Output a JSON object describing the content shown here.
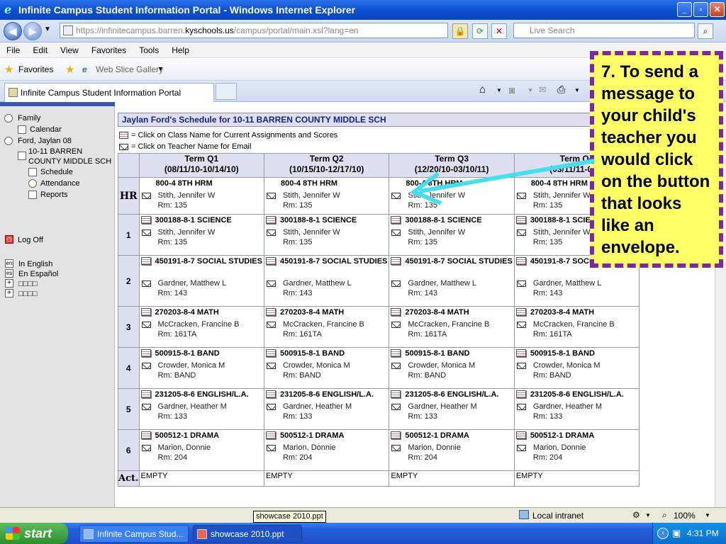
{
  "window": {
    "title": "Infinite Campus Student Information Portal - Windows Internet Explorer"
  },
  "address": {
    "url_prefix": "https://infinitecampus.barren.",
    "url_domain": "kyschools.us",
    "url_suffix": "/campus/portal/main.xsl?lang=en",
    "search_placeholder": "Live Search"
  },
  "menu": [
    "File",
    "Edit",
    "View",
    "Favorites",
    "Tools",
    "Help"
  ],
  "favorites": {
    "label": "Favorites",
    "gallery": "Web Slice Gallery"
  },
  "tab": {
    "title": "Infinite Campus Student Information Portal"
  },
  "sidebar": {
    "family": "Family",
    "calendar": "Calendar",
    "student": "Ford, Jaylan 08",
    "school_line1": "10-11 BARREN",
    "school_line2": "COUNTY MIDDLE SCH",
    "schedule": "Schedule",
    "attendance": "Attendance",
    "reports": "Reports",
    "logoff": "Log Off",
    "lang_en_code": "en",
    "lang_en": "In English",
    "lang_es_code": "es",
    "lang_es": "En Español",
    "lang_other1": "□□□□",
    "lang_other2": "□□□□",
    "lang_other_code": "+"
  },
  "schedule": {
    "heading": "Jaylan Ford's Schedule for 10-11 BARREN COUNTY MIDDLE SCH",
    "legend_class": "= Click on Class Name for Current Assignments and Scores",
    "legend_teacher": "= Click on Teacher Name for Email",
    "terms": [
      {
        "name": "Term Q1",
        "dates": "(08/11/10-10/14/10)"
      },
      {
        "name": "Term Q2",
        "dates": "(10/15/10-12/17/10)"
      },
      {
        "name": "Term Q3",
        "dates": "(12/20/10-03/10/11)"
      },
      {
        "name": "Term Q4",
        "dates": "(03/11/11-06/0"
      }
    ],
    "periods": [
      {
        "label": "HR",
        "course": "800-4 8TH HRM",
        "teacher": "Stith, Jennifer W",
        "room": "Rm: 135",
        "has_class_icon": false
      },
      {
        "label": "1",
        "course": "300188-8-1 SCIENCE",
        "teacher": "Stith, Jennifer W",
        "room": "Rm: 135",
        "has_class_icon": true
      },
      {
        "label": "2",
        "course": "450191-8-7 SOCIAL STUDIES",
        "teacher": "Gardner, Matthew L",
        "room": "Rm: 143",
        "has_class_icon": true
      },
      {
        "label": "3",
        "course": "270203-8-4 MATH",
        "teacher": "McCracken, Francine B",
        "room": "Rm: 161TA",
        "has_class_icon": true
      },
      {
        "label": "4",
        "course": "500915-8-1 BAND",
        "teacher": "Crowder, Monica M",
        "room": "Rm: BAND",
        "has_class_icon": true
      },
      {
        "label": "5",
        "course": "231205-8-6 ENGLISH/L.A.",
        "teacher": "Gardner, Heather M",
        "room": "Rm: 133",
        "has_class_icon": true
      },
      {
        "label": "6",
        "course": "500512-1 DRAMA",
        "teacher": "Marion, Donnie",
        "room": "Rm: 204",
        "has_class_icon": true
      }
    ],
    "activity": {
      "label": "Act.",
      "value": "EMPTY"
    }
  },
  "callout": {
    "text": "7. To send a message to your child's teacher you would click on the button that looks like an envelope."
  },
  "status": {
    "zone": "Local intranet",
    "zoom": "100%",
    "tooltip": "showcase 2010.ppt"
  },
  "taskbar": {
    "start": "start",
    "task1": "Infinite Campus Stud...",
    "task2": "showcase 2010.ppt",
    "clock": "4:31 PM"
  },
  "colors": {
    "callout_fill": "#ffff66",
    "callout_border": "#7a2a9a",
    "arrow": "#44e0f0",
    "header_bg": "#dedff0"
  }
}
